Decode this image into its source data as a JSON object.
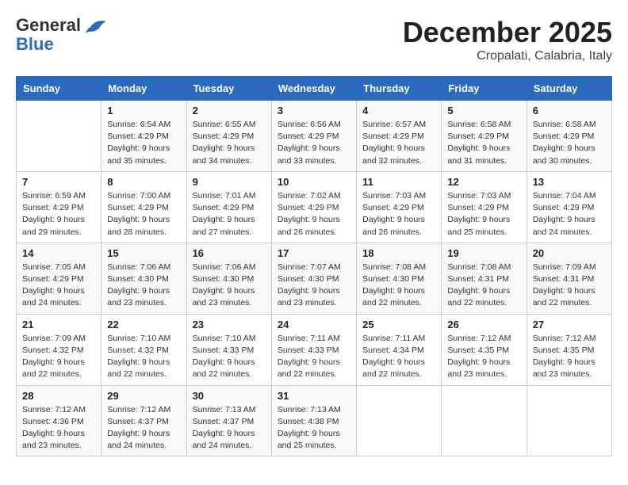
{
  "header": {
    "logo_general": "General",
    "logo_blue": "Blue",
    "month": "December 2025",
    "location": "Cropalati, Calabria, Italy"
  },
  "columns": [
    "Sunday",
    "Monday",
    "Tuesday",
    "Wednesday",
    "Thursday",
    "Friday",
    "Saturday"
  ],
  "weeks": [
    [
      {
        "day": "",
        "info": ""
      },
      {
        "day": "1",
        "info": "Sunrise: 6:54 AM\nSunset: 4:29 PM\nDaylight: 9 hours\nand 35 minutes."
      },
      {
        "day": "2",
        "info": "Sunrise: 6:55 AM\nSunset: 4:29 PM\nDaylight: 9 hours\nand 34 minutes."
      },
      {
        "day": "3",
        "info": "Sunrise: 6:56 AM\nSunset: 4:29 PM\nDaylight: 9 hours\nand 33 minutes."
      },
      {
        "day": "4",
        "info": "Sunrise: 6:57 AM\nSunset: 4:29 PM\nDaylight: 9 hours\nand 32 minutes."
      },
      {
        "day": "5",
        "info": "Sunrise: 6:58 AM\nSunset: 4:29 PM\nDaylight: 9 hours\nand 31 minutes."
      },
      {
        "day": "6",
        "info": "Sunrise: 6:58 AM\nSunset: 4:29 PM\nDaylight: 9 hours\nand 30 minutes."
      }
    ],
    [
      {
        "day": "7",
        "info": "Sunrise: 6:59 AM\nSunset: 4:29 PM\nDaylight: 9 hours\nand 29 minutes."
      },
      {
        "day": "8",
        "info": "Sunrise: 7:00 AM\nSunset: 4:29 PM\nDaylight: 9 hours\nand 28 minutes."
      },
      {
        "day": "9",
        "info": "Sunrise: 7:01 AM\nSunset: 4:29 PM\nDaylight: 9 hours\nand 27 minutes."
      },
      {
        "day": "10",
        "info": "Sunrise: 7:02 AM\nSunset: 4:29 PM\nDaylight: 9 hours\nand 26 minutes."
      },
      {
        "day": "11",
        "info": "Sunrise: 7:03 AM\nSunset: 4:29 PM\nDaylight: 9 hours\nand 26 minutes."
      },
      {
        "day": "12",
        "info": "Sunrise: 7:03 AM\nSunset: 4:29 PM\nDaylight: 9 hours\nand 25 minutes."
      },
      {
        "day": "13",
        "info": "Sunrise: 7:04 AM\nSunset: 4:29 PM\nDaylight: 9 hours\nand 24 minutes."
      }
    ],
    [
      {
        "day": "14",
        "info": "Sunrise: 7:05 AM\nSunset: 4:29 PM\nDaylight: 9 hours\nand 24 minutes."
      },
      {
        "day": "15",
        "info": "Sunrise: 7:06 AM\nSunset: 4:30 PM\nDaylight: 9 hours\nand 23 minutes."
      },
      {
        "day": "16",
        "info": "Sunrise: 7:06 AM\nSunset: 4:30 PM\nDaylight: 9 hours\nand 23 minutes."
      },
      {
        "day": "17",
        "info": "Sunrise: 7:07 AM\nSunset: 4:30 PM\nDaylight: 9 hours\nand 23 minutes."
      },
      {
        "day": "18",
        "info": "Sunrise: 7:08 AM\nSunset: 4:30 PM\nDaylight: 9 hours\nand 22 minutes."
      },
      {
        "day": "19",
        "info": "Sunrise: 7:08 AM\nSunset: 4:31 PM\nDaylight: 9 hours\nand 22 minutes."
      },
      {
        "day": "20",
        "info": "Sunrise: 7:09 AM\nSunset: 4:31 PM\nDaylight: 9 hours\nand 22 minutes."
      }
    ],
    [
      {
        "day": "21",
        "info": "Sunrise: 7:09 AM\nSunset: 4:32 PM\nDaylight: 9 hours\nand 22 minutes."
      },
      {
        "day": "22",
        "info": "Sunrise: 7:10 AM\nSunset: 4:32 PM\nDaylight: 9 hours\nand 22 minutes."
      },
      {
        "day": "23",
        "info": "Sunrise: 7:10 AM\nSunset: 4:33 PM\nDaylight: 9 hours\nand 22 minutes."
      },
      {
        "day": "24",
        "info": "Sunrise: 7:11 AM\nSunset: 4:33 PM\nDaylight: 9 hours\nand 22 minutes."
      },
      {
        "day": "25",
        "info": "Sunrise: 7:11 AM\nSunset: 4:34 PM\nDaylight: 9 hours\nand 22 minutes."
      },
      {
        "day": "26",
        "info": "Sunrise: 7:12 AM\nSunset: 4:35 PM\nDaylight: 9 hours\nand 23 minutes."
      },
      {
        "day": "27",
        "info": "Sunrise: 7:12 AM\nSunset: 4:35 PM\nDaylight: 9 hours\nand 23 minutes."
      }
    ],
    [
      {
        "day": "28",
        "info": "Sunrise: 7:12 AM\nSunset: 4:36 PM\nDaylight: 9 hours\nand 23 minutes."
      },
      {
        "day": "29",
        "info": "Sunrise: 7:12 AM\nSunset: 4:37 PM\nDaylight: 9 hours\nand 24 minutes."
      },
      {
        "day": "30",
        "info": "Sunrise: 7:13 AM\nSunset: 4:37 PM\nDaylight: 9 hours\nand 24 minutes."
      },
      {
        "day": "31",
        "info": "Sunrise: 7:13 AM\nSunset: 4:38 PM\nDaylight: 9 hours\nand 25 minutes."
      },
      {
        "day": "",
        "info": ""
      },
      {
        "day": "",
        "info": ""
      },
      {
        "day": "",
        "info": ""
      }
    ]
  ]
}
